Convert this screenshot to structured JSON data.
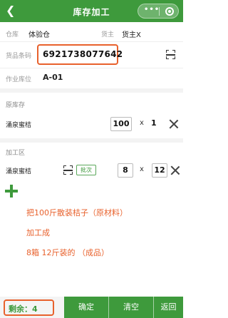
{
  "header": {
    "back_icon": "chevron-left-icon",
    "title": "库存加工",
    "more_icon": "more-dots-icon",
    "record_icon": "record-icon"
  },
  "info": {
    "warehouse_label": "仓库",
    "warehouse_value": "体验仓",
    "owner_label": "货主",
    "owner_value": "货主X",
    "barcode_label": "货品条码",
    "barcode_value": "6921738077642",
    "location_label": "作业库位",
    "location_value": "A-01"
  },
  "original": {
    "section_title": "原库存",
    "item_name": "涌泉蜜桔",
    "qty": "100",
    "mult": "x",
    "factor": "1"
  },
  "processing": {
    "section_title": "加工区",
    "item_name": "涌泉蜜桔",
    "batch_label": "批次",
    "qty": "8",
    "mult": "x",
    "factor": "12"
  },
  "notes": [
    "把100斤散装桔子（原材料）",
    "加工成",
    "8箱 12斤装的 （成品）"
  ],
  "footer": {
    "remain_label": "剩余：4",
    "confirm": "确定",
    "clear": "清空",
    "back": "返回"
  },
  "colors": {
    "brand_green": "#3e9a3c",
    "highlight_orange": "#e8612c"
  }
}
